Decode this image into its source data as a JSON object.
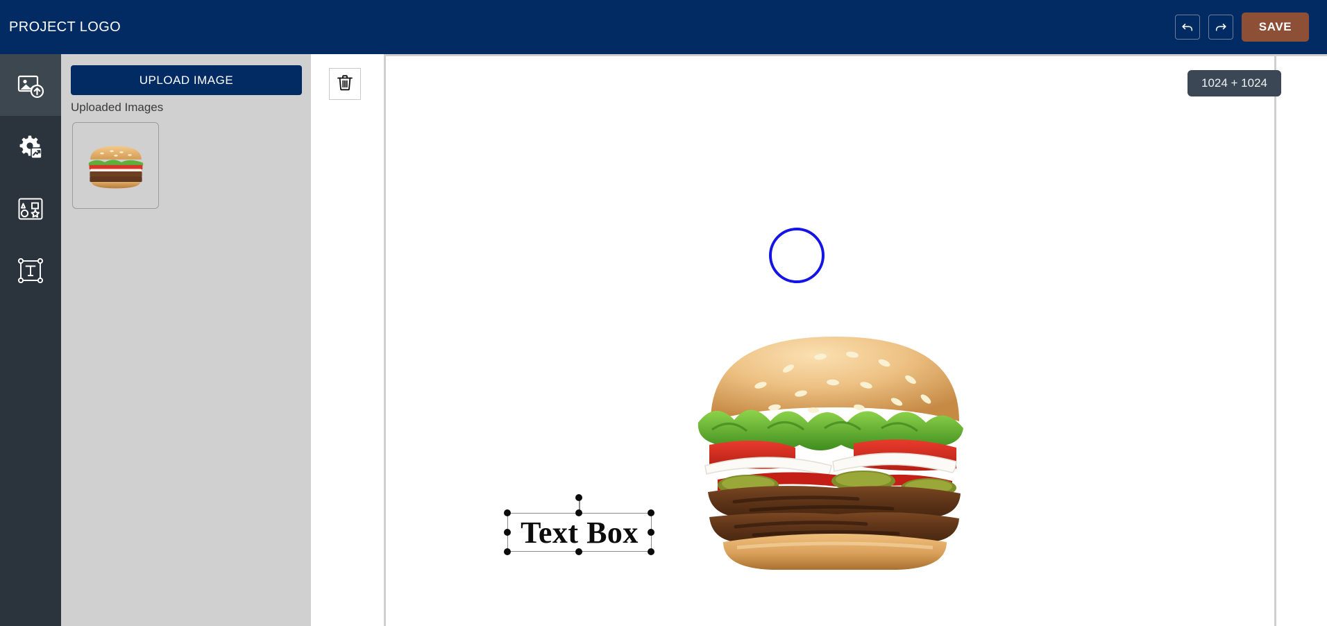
{
  "header": {
    "brand": "PROJECT LOGO",
    "undo_icon": "undo-arrow-icon",
    "redo_icon": "redo-arrow-icon",
    "save_label": "SAVE",
    "background_color": "#012B62",
    "save_color": "#8D4F35"
  },
  "sidebar": {
    "background_color": "#2B333D",
    "active_color": "#3D4750",
    "items": [
      {
        "name": "image-upload",
        "icon": "image-upload-icon",
        "active": true
      },
      {
        "name": "settings-chart",
        "icon": "gear-chart-icon",
        "active": false
      },
      {
        "name": "shapes",
        "icon": "shapes-icon",
        "active": false
      },
      {
        "name": "text",
        "icon": "text-box-icon",
        "active": false
      }
    ]
  },
  "panel": {
    "background_color": "#D0D0D0",
    "upload_button_label": "UPLOAD IMAGE",
    "uploaded_images_label": "Uploaded Images",
    "thumbnails": [
      {
        "name": "burger-thumbnail",
        "alt": "burger"
      }
    ]
  },
  "toolbar": {
    "delete_icon": "trash-icon"
  },
  "canvas": {
    "size_badge": "1024 + 1024",
    "badge_color": "#3B4754",
    "objects": {
      "circle": {
        "name": "circle-shape",
        "stroke_color": "#1414E6",
        "fill": "none"
      },
      "image": {
        "name": "burger-image",
        "alt": "burger"
      },
      "textbox": {
        "name": "text-box",
        "text": "Text Box",
        "selected": true,
        "handle_color": "#0b0b0b"
      }
    }
  }
}
